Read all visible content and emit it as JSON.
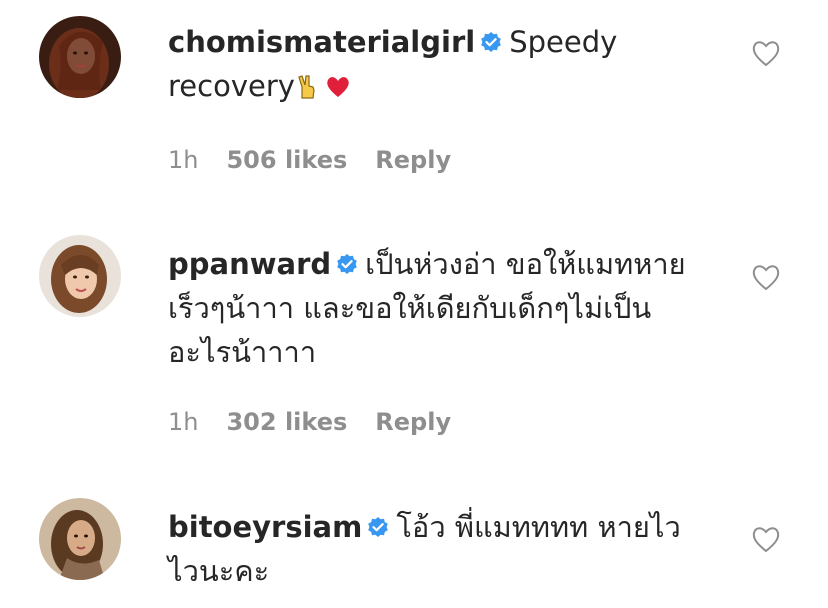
{
  "comments": [
    {
      "username": "chomismaterialgirl",
      "text": "Speedy recovery",
      "emojis": [
        "victory-hand",
        "red-heart"
      ],
      "time": "1h",
      "likes": "506 likes",
      "reply_label": "Reply",
      "verified": true
    },
    {
      "username": "ppanward",
      "text": "เป็นห่วงอ่า ขอให้แมทหายเร็วๆน้าาา และขอให้เดียกับเด็กๆไม่เป็นอะไรน้าาาา",
      "time": "1h",
      "likes": "302 likes",
      "reply_label": "Reply",
      "verified": true
    },
    {
      "username": "bitoeyrsiam",
      "text": "โอ้ว พี่แมทททท หายไวไวนะคะ",
      "time": "",
      "likes": "",
      "reply_label": "",
      "verified": true
    }
  ],
  "colors": {
    "text": "#262626",
    "meta": "#8e8e8e",
    "verified": "#3897f0",
    "heart": "#ed4956"
  },
  "icons": {
    "verified": "verified-badge-icon",
    "like": "heart-outline-icon"
  }
}
